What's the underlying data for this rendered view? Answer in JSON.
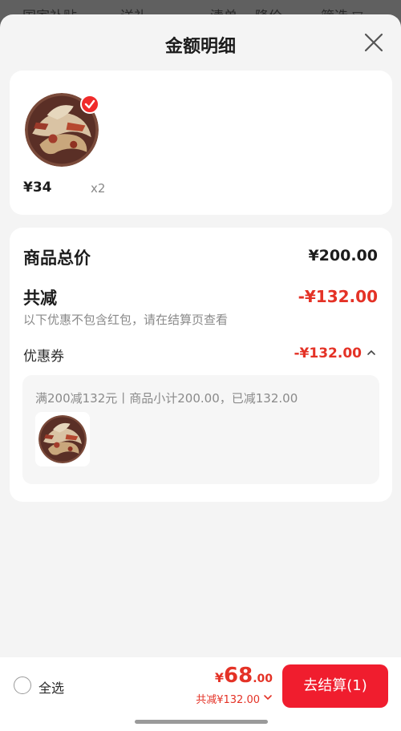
{
  "background_tabs": [
    "国家补贴",
    "送礼",
    "清单",
    "降价",
    "筛选 ▽"
  ],
  "sheet": {
    "title": "金额明细"
  },
  "item": {
    "price": "¥34",
    "quantity": "x2"
  },
  "summary": {
    "total_label": "商品总价",
    "total_amount": "¥200.00",
    "reduce_label": "共减",
    "reduce_amount": "-¥132.00",
    "reduce_note": "以下优惠不包含红包，请在结算页查看",
    "coupon_label": "优惠券",
    "coupon_amount": "-¥132.00",
    "coupon_desc": "满200减132元丨商品小计200.00，已减132.00"
  },
  "footer": {
    "select_all": "全选",
    "pay_currency": "¥",
    "pay_int": "68",
    "pay_dec": ".00",
    "pay_saved": "共减¥132.00",
    "checkout_label": "去结算(1)"
  },
  "colors": {
    "accent": "#f01d2e",
    "price_red": "#e43226"
  },
  "icons": [
    "close-icon",
    "check-badge-icon",
    "chevron-up-icon",
    "chevron-down-icon",
    "radio-icon"
  ]
}
